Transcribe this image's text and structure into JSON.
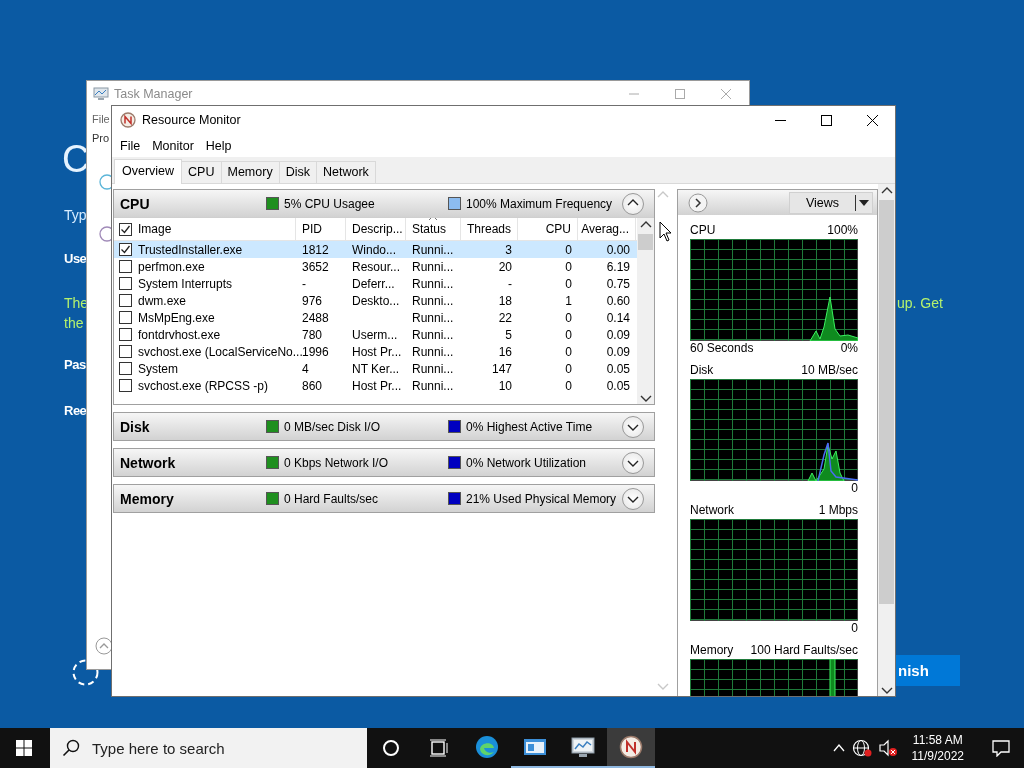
{
  "desktop_page": {
    "texts": [
      {
        "kind": "heading",
        "text": "C"
      },
      {
        "kind": "prompt",
        "text": "Typ"
      },
      {
        "kind": "label",
        "text": "Use"
      },
      {
        "kind": "note",
        "text": "The"
      },
      {
        "kind": "note",
        "text": "the"
      },
      {
        "kind": "label",
        "text": "Pas"
      },
      {
        "kind": "label",
        "text": "Ree"
      },
      {
        "kind": "note",
        "text": "up. Get"
      }
    ],
    "finish_button": "nish"
  },
  "task_manager": {
    "title": "Task Manager",
    "menu": [
      "File"
    ],
    "tabs": [
      "Pro"
    ]
  },
  "resource_monitor": {
    "title": "Resource Monitor",
    "menu": [
      "File",
      "Monitor",
      "Help"
    ],
    "tabs": [
      {
        "label": "Overview",
        "selected": true
      },
      {
        "label": "CPU",
        "selected": false
      },
      {
        "label": "Memory",
        "selected": false
      },
      {
        "label": "Disk",
        "selected": false
      },
      {
        "label": "Network",
        "selected": false
      }
    ],
    "sections": [
      {
        "title": "CPU",
        "expanded": true,
        "metrics": [
          {
            "text": "5% CPU Usagee",
            "color": "#1f8f1f"
          },
          {
            "text": "100% Maximum Frequency",
            "color": "#8cbcf0"
          }
        ],
        "table": {
          "all_checked": true,
          "columns": [
            {
              "label": "Image",
              "sorted": false
            },
            {
              "label": "PID",
              "sorted": false
            },
            {
              "label": "Descrip...",
              "sorted": false
            },
            {
              "label": "Status",
              "sorted": true
            },
            {
              "label": "Threads",
              "sorted": false
            },
            {
              "label": "CPU",
              "sorted": false
            },
            {
              "label": "Averag...",
              "sorted": false
            }
          ],
          "rows": [
            {
              "checked": true,
              "selected": true,
              "cells": [
                "TrustedInstaller.exe",
                "1812",
                "Windo...",
                "Runni...",
                "3",
                "0",
                "0.00"
              ]
            },
            {
              "checked": false,
              "selected": false,
              "cells": [
                "perfmon.exe",
                "3652",
                "Resour...",
                "Runni...",
                "20",
                "0",
                "6.19"
              ]
            },
            {
              "checked": false,
              "selected": false,
              "cells": [
                "System Interrupts",
                "-",
                "Deferr...",
                "Runni...",
                "-",
                "0",
                "0.75"
              ]
            },
            {
              "checked": false,
              "selected": false,
              "cells": [
                "dwm.exe",
                "976",
                "Deskto...",
                "Runni...",
                "18",
                "1",
                "0.60"
              ]
            },
            {
              "checked": false,
              "selected": false,
              "cells": [
                "MsMpEng.exe",
                "2488",
                "",
                "Runni...",
                "22",
                "0",
                "0.14"
              ]
            },
            {
              "checked": false,
              "selected": false,
              "cells": [
                "fontdrvhost.exe",
                "780",
                "Userm...",
                "Runni...",
                "5",
                "0",
                "0.09"
              ]
            },
            {
              "checked": false,
              "selected": false,
              "cells": [
                "svchost.exe (LocalServiceNo...",
                "1996",
                "Host Pr...",
                "Runni...",
                "16",
                "0",
                "0.09"
              ]
            },
            {
              "checked": false,
              "selected": false,
              "cells": [
                "System",
                "4",
                "NT Ker...",
                "Runni...",
                "147",
                "0",
                "0.05"
              ]
            },
            {
              "checked": false,
              "selected": false,
              "cells": [
                "svchost.exe (RPCSS -p)",
                "860",
                "Host Pr...",
                "Runni...",
                "10",
                "0",
                "0.05"
              ]
            }
          ]
        }
      },
      {
        "title": "Disk",
        "expanded": false,
        "metrics": [
          {
            "text": "0 MB/sec Disk I/O",
            "color": "#1f8f1f"
          },
          {
            "text": "0% Highest Active Time",
            "color": "#0000c0"
          }
        ]
      },
      {
        "title": "Network",
        "expanded": false,
        "metrics": [
          {
            "text": "0 Kbps Network I/O",
            "color": "#1f8f1f"
          },
          {
            "text": "0% Network Utilization",
            "color": "#0000c0"
          }
        ]
      },
      {
        "title": "Memory",
        "expanded": false,
        "metrics": [
          {
            "text": "0 Hard Faults/sec",
            "color": "#1f8f1f"
          },
          {
            "text": "21% Used Physical Memory",
            "color": "#0000c0"
          }
        ]
      }
    ],
    "side_panel": {
      "views_button": "Views",
      "graphs": [
        {
          "kind": "cpu",
          "title": "CPU",
          "max": "100%",
          "time": "60 Seconds",
          "min": "0%"
        },
        {
          "kind": "disk",
          "title": "Disk",
          "max": "10 MB/sec",
          "min": "0"
        },
        {
          "kind": "network",
          "title": "Network",
          "max": "1 Mbps",
          "min": "0"
        },
        {
          "kind": "memory",
          "title": "Memory",
          "max": "100 Hard Faults/sec"
        }
      ]
    }
  },
  "taskbar": {
    "search_placeholder": "Type here to search",
    "apps": [
      {
        "kind": "edge",
        "running": false,
        "active": false
      },
      {
        "kind": "window",
        "running": true,
        "active": false
      },
      {
        "kind": "perfmon",
        "running": true,
        "active": false
      },
      {
        "kind": "resmon",
        "running": true,
        "active": true
      }
    ],
    "time": "11:58 AM",
    "date": "11/9/2022"
  }
}
